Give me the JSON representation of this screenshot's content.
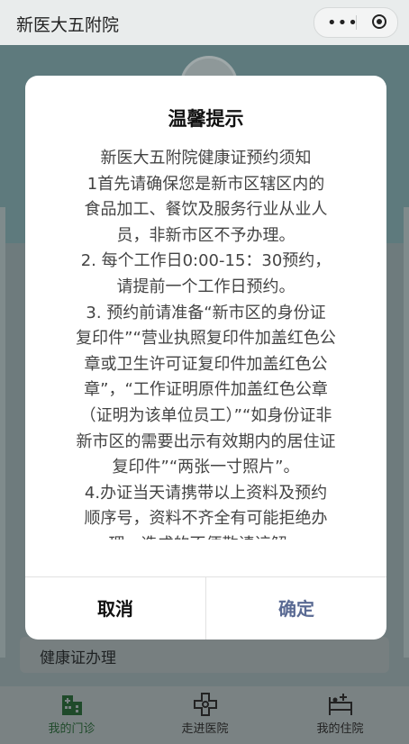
{
  "app": {
    "title": "新医大五附院"
  },
  "capsule": {
    "more_icon": "more-dots-icon",
    "close_icon": "target-circle-icon"
  },
  "modal": {
    "title": "温馨提示",
    "lines": [
      "新医大五附院健康证预约须知",
      "1首先请确保您是新市区辖区内的",
      "食品加工、餐饮及服务行业从业人",
      "员，非新市区不予办理。",
      "2. 每个工作日0:00-15：30预约，",
      "请提前一个工作日预约。",
      "3. 预约前请准备“新市区的身份证",
      "复印件”“营业执照复印件加盖红色公",
      "章或卫生许可证复印件加盖红色公",
      "章”，“工作证明原件加盖红色公章",
      "（证明为该单位员工）”“如身份证非",
      "新市区的需要出示有效期内的居住证",
      "复印件”“两张一寸照片”。",
      "4.办证当天请携带以上资料及预约",
      "顺序号，资料不齐全有可能拒绝办",
      "理，造成的不便敬请谅解。"
    ],
    "cancel_label": "取消",
    "confirm_label": "确定",
    "confirm_color": "#5a6a93"
  },
  "page": {
    "card_label": "健康证办理"
  },
  "tabbar": {
    "items": [
      {
        "label": "我的门诊",
        "icon": "hospital-building-icon",
        "active": true
      },
      {
        "label": "走进医院",
        "icon": "medical-cross-icon",
        "active": false
      },
      {
        "label": "我的住院",
        "icon": "hospital-bed-icon",
        "active": false
      }
    ]
  }
}
